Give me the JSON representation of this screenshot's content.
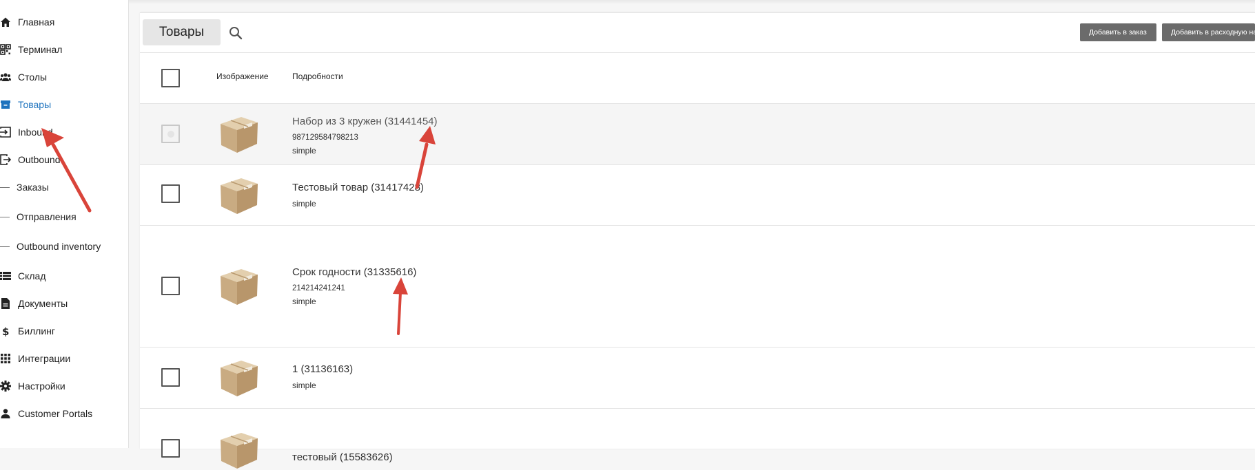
{
  "sidebar": {
    "items": [
      {
        "label": "Главная",
        "icon": "home-icon"
      },
      {
        "label": "Терминал",
        "icon": "qr-code-icon"
      },
      {
        "label": "Столы",
        "icon": "people-icon"
      },
      {
        "label": "Товары",
        "icon": "archive-box-icon"
      },
      {
        "label": "Inbound",
        "icon": "login-arrow-icon"
      },
      {
        "label": "Outbound",
        "icon": "logout-arrow-icon"
      },
      {
        "label": "Заказы",
        "icon": "dash"
      },
      {
        "label": "Отправления",
        "icon": "dash"
      },
      {
        "label": "Outbound inventory",
        "icon": "dash"
      },
      {
        "label": "Склад",
        "icon": "list-icon"
      },
      {
        "label": "Документы",
        "icon": "document-icon"
      },
      {
        "label": "Биллинг",
        "icon": "dollar-icon"
      },
      {
        "label": "Интеграции",
        "icon": "grid-apps-icon"
      },
      {
        "label": "Настройки",
        "icon": "gear-icon"
      },
      {
        "label": "Customer Portals",
        "icon": "person-icon"
      }
    ],
    "active": "Товары",
    "active_color": "#1e73be"
  },
  "header": {
    "title": "Товары",
    "add_to_order": "Добавить в заказ",
    "add_to_outbound": "Добавить в расходную на"
  },
  "table": {
    "columns": {
      "image": "Изображение",
      "details": "Подробности"
    },
    "rows": [
      {
        "name": "Набор из 3 кружен (31441454)",
        "sku": "987129584798213",
        "type": "simple"
      },
      {
        "name": "Тестовый товар (31417428)",
        "sku": "",
        "type": "simple"
      },
      {
        "name": "Срок годности (31335616)",
        "sku": "214214241241",
        "type": "simple"
      },
      {
        "name": "1 (31136163)",
        "sku": "",
        "type": "simple"
      },
      {
        "name": "тестовый (15583626)",
        "sku": "",
        "type": ""
      }
    ]
  },
  "colors": {
    "annotation_arrow": "#d9443a",
    "button_dark": "#6b6b6b"
  }
}
